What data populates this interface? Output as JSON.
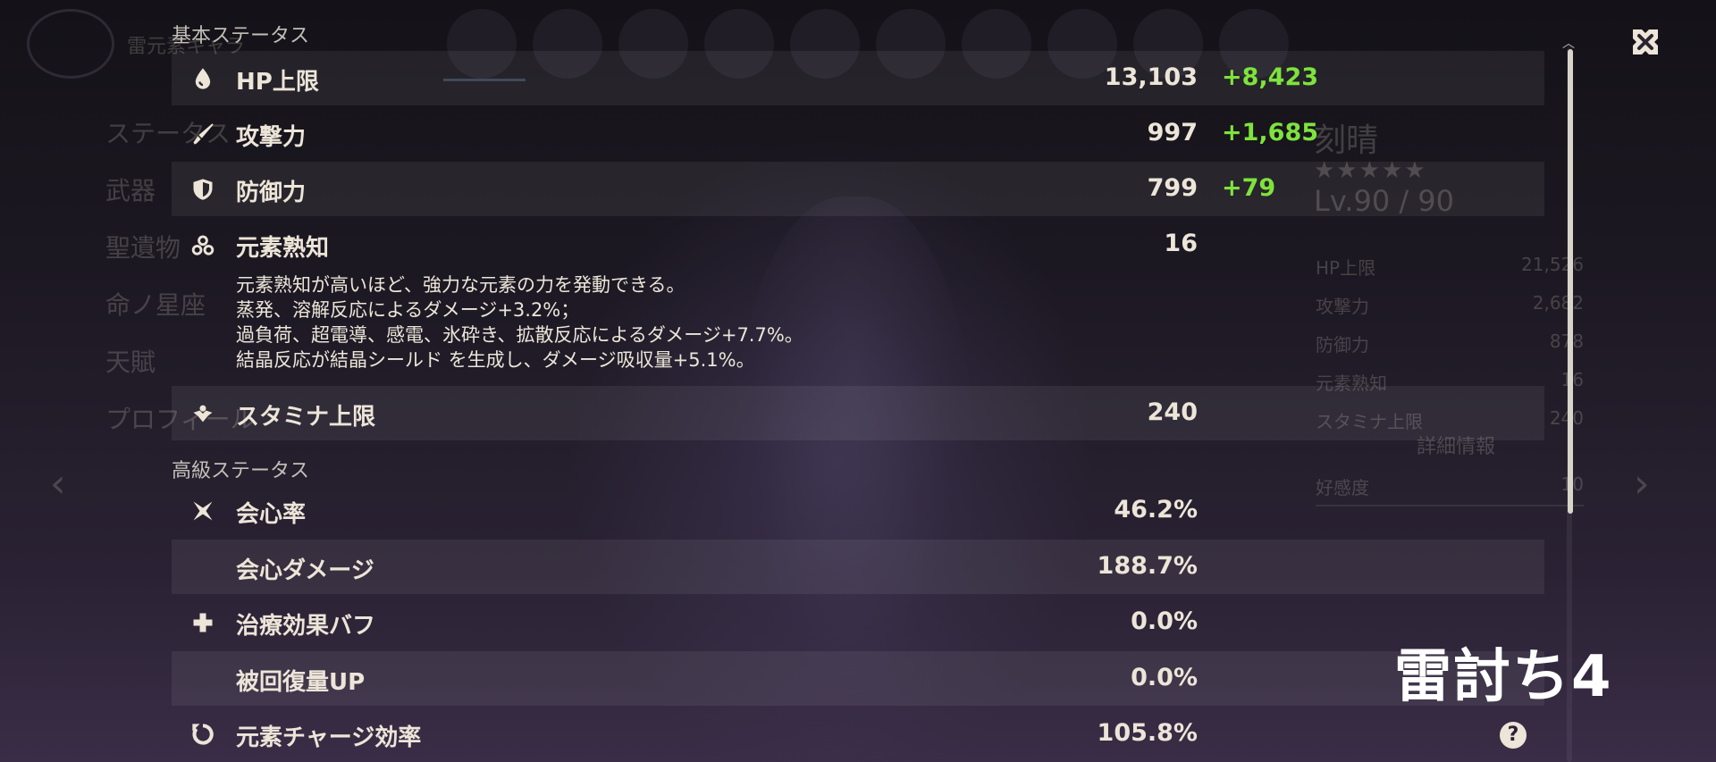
{
  "background": {
    "element_title": "雷元素キャラ",
    "menu_items": [
      "ステータス",
      "武器",
      "聖遺物",
      "命ノ星座",
      "天賦",
      "プロフィール"
    ],
    "character_name": "刻晴",
    "stars": "★★★★★",
    "level": "Lv.90 / 90",
    "stats": [
      {
        "name": "HP上限",
        "value": "21,526"
      },
      {
        "name": "攻撃力",
        "value": "2,682"
      },
      {
        "name": "防御力",
        "value": "878"
      },
      {
        "name": "元素熟知",
        "value": "16"
      },
      {
        "name": "スタミナ上限",
        "value": "240"
      }
    ],
    "detail_button": "詳細情報",
    "affection_label": "好感度",
    "affection_value": "10"
  },
  "basic_section_label": "基本ステータス",
  "advanced_section_label": "高級ステータス",
  "basic_stats": [
    {
      "name": "HP上限",
      "value": "13,103",
      "bonus": "+8,423",
      "icon": "hp-drop-icon"
    },
    {
      "name": "攻撃力",
      "value": "997",
      "bonus": "+1,685",
      "icon": "attack-sword-icon"
    },
    {
      "name": "防御力",
      "value": "799",
      "bonus": "+79",
      "icon": "defense-shield-icon"
    },
    {
      "name": "元素熟知",
      "value": "16",
      "bonus": "",
      "icon": "elemental-mastery-icon"
    },
    {
      "name": "スタミナ上限",
      "value": "240",
      "bonus": "",
      "icon": "stamina-icon"
    }
  ],
  "em_description": [
    "元素熟知が高いほど、強力な元素の力を発動できる。",
    "蒸発、溶解反応によるダメージ+3.2%；",
    "過負荷、超電導、感電、氷砕き、拡散反応によるダメージ+7.7%。",
    "結晶反応が結晶シールド を生成し、ダメージ吸収量+5.1%。"
  ],
  "advanced_stats": [
    {
      "name": "会心率",
      "value": "46.2%",
      "icon": "crit-rate-icon"
    },
    {
      "name": "会心ダメージ",
      "value": "188.7%",
      "icon": ""
    },
    {
      "name": "治療効果バフ",
      "value": "0.0%",
      "icon": "healing-cross-icon"
    },
    {
      "name": "被回復量UP",
      "value": "0.0%",
      "icon": ""
    },
    {
      "name": "元素チャージ効率",
      "value": "105.8%",
      "icon": "energy-recharge-icon"
    }
  ],
  "help_icon_glyph": "?",
  "overlay_caption": "雷討ち4",
  "colors": {
    "bonus_green": "#7ee33c",
    "text_primary": "#ece5d8",
    "row_tint": "rgba(255,255,255,0.065)"
  }
}
